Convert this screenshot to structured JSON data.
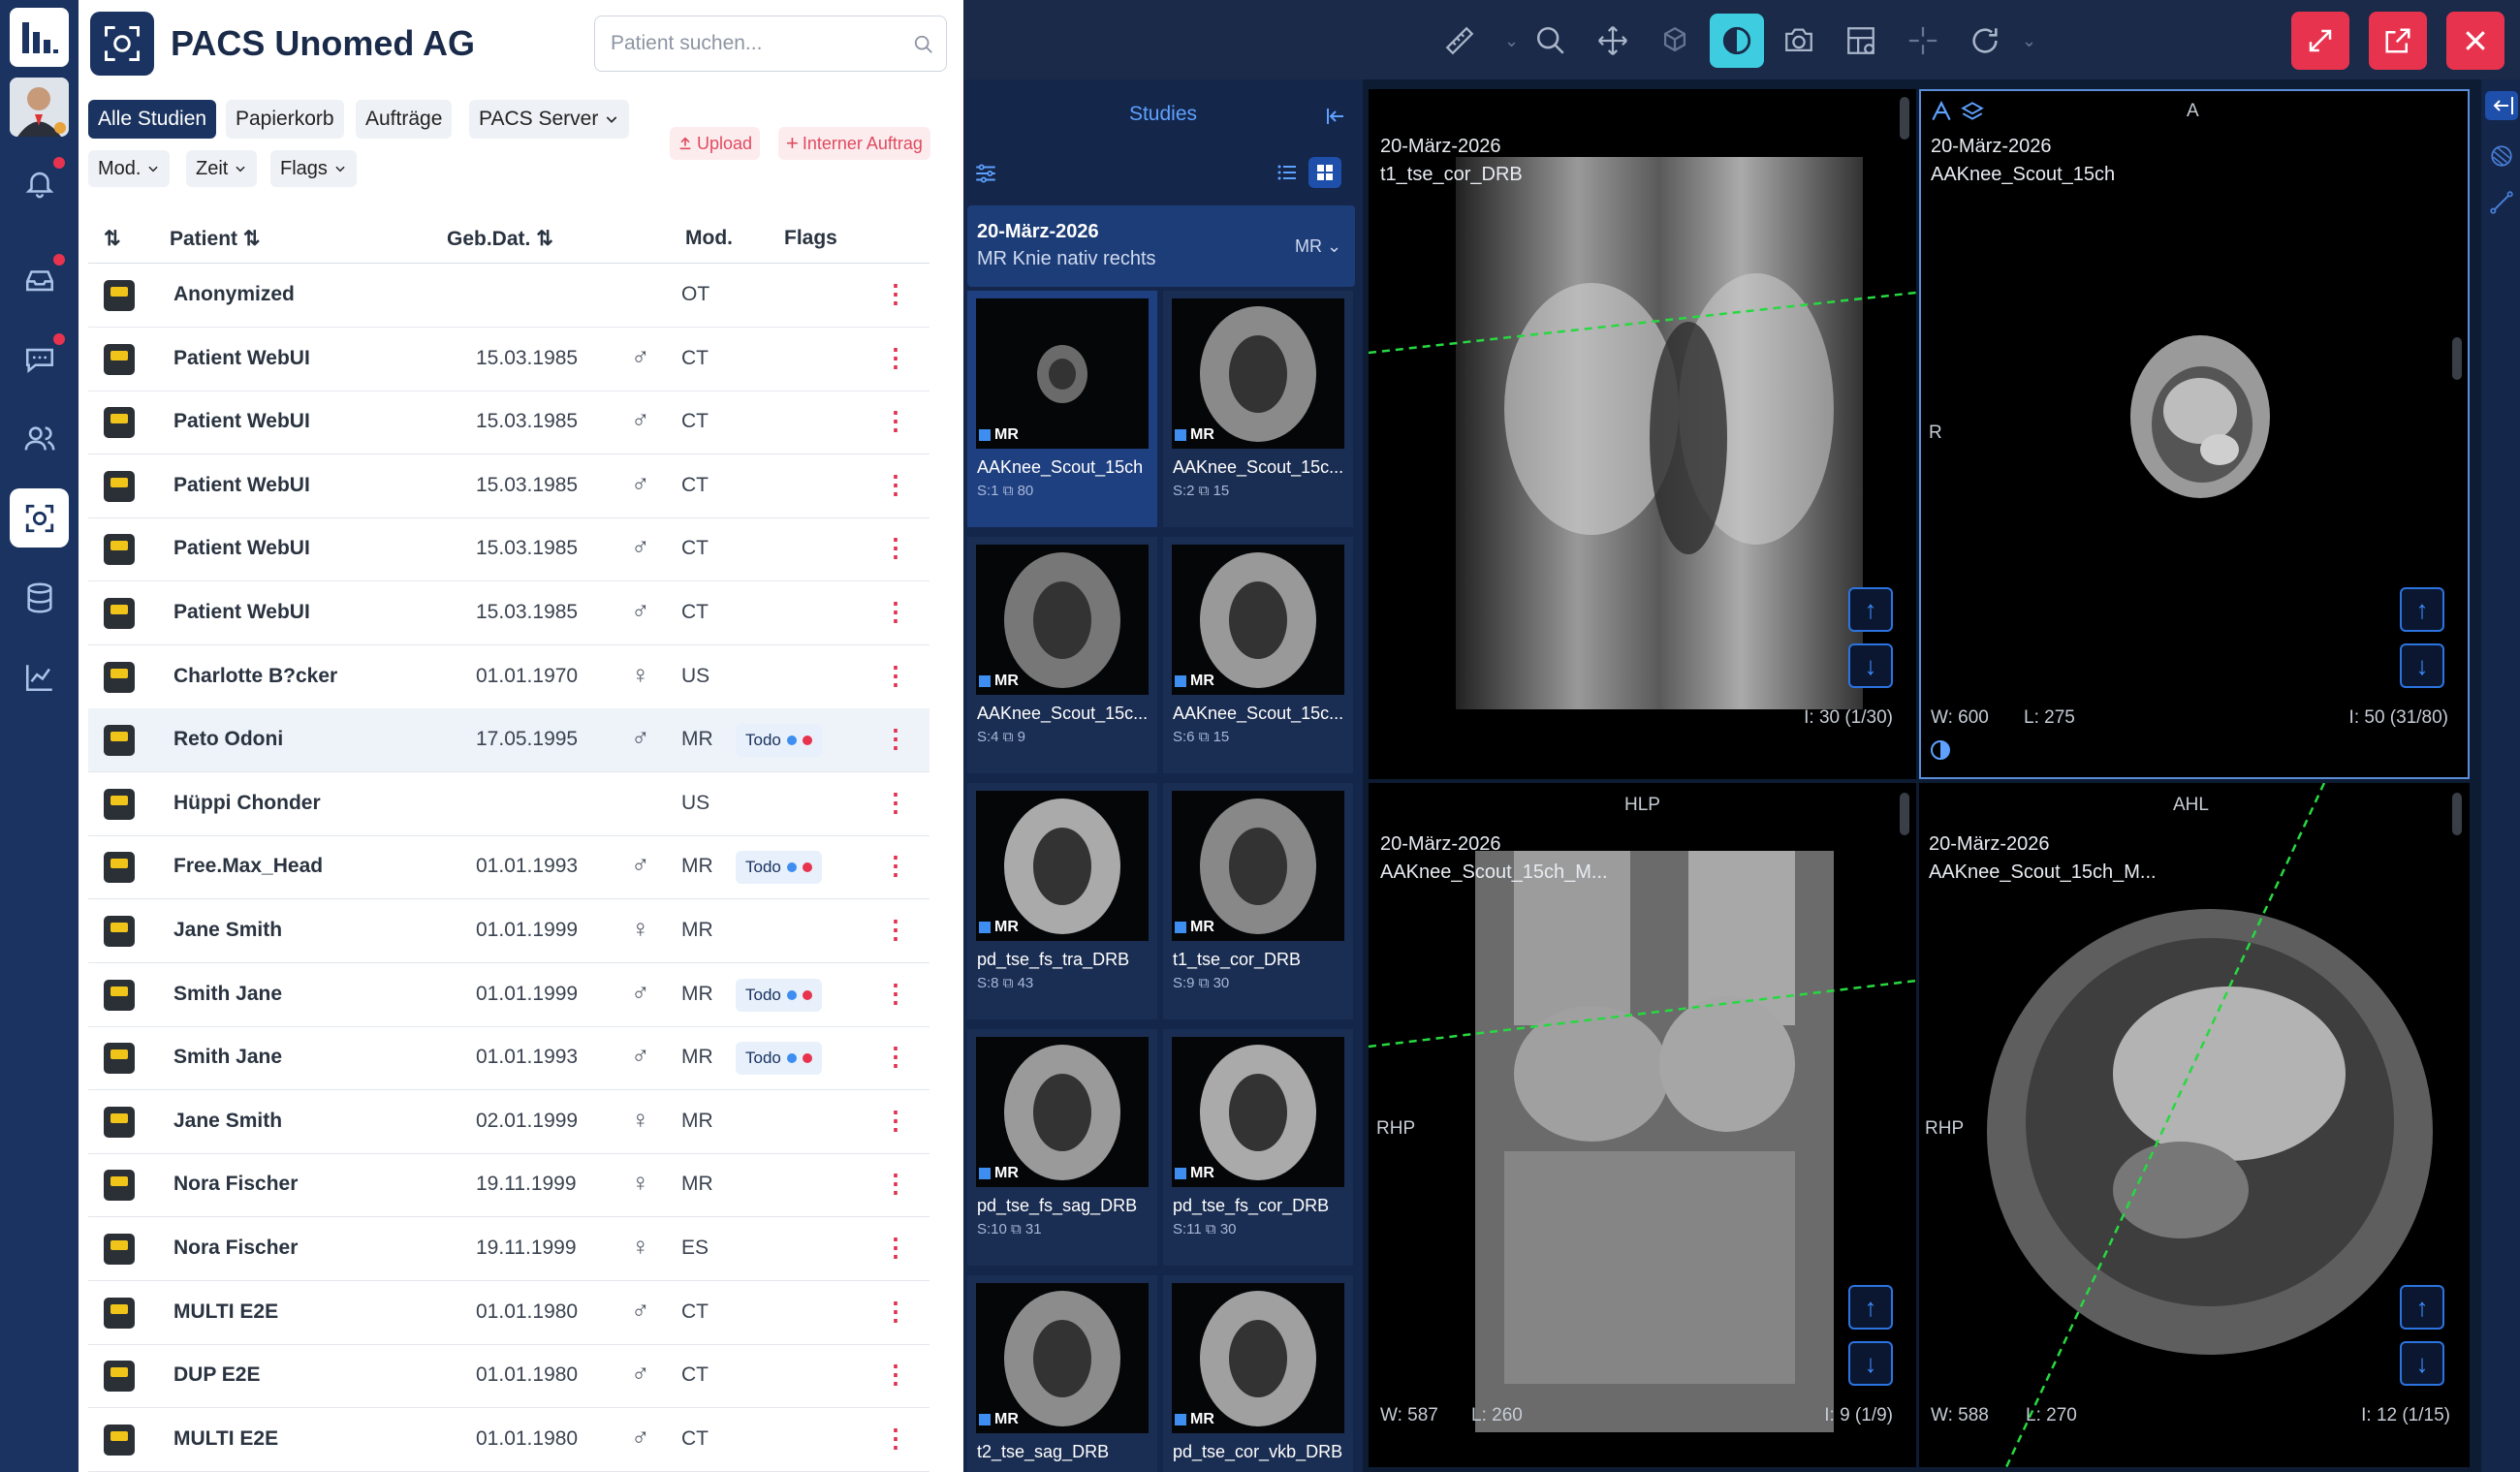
{
  "org": {
    "name": "PACS Unomed AG"
  },
  "search": {
    "placeholder": "Patient suchen..."
  },
  "tabs": [
    "Alle Studien",
    "Papierkorb",
    "Aufträge",
    "PACS Server"
  ],
  "filters": [
    "Mod.",
    "Zeit",
    "Flags"
  ],
  "actions": {
    "upload": "Upload",
    "internal": "Interner Auftrag"
  },
  "table": {
    "headers": {
      "patient": "Patient",
      "dob": "Geb.Dat.",
      "mod": "Mod.",
      "flags": "Flags"
    },
    "rows": [
      {
        "name": "Anonymized",
        "dob": "",
        "sex": "",
        "mod": "OT",
        "flag": ""
      },
      {
        "name": "Patient WebUI",
        "dob": "15.03.1985",
        "sex": "♂",
        "mod": "CT",
        "flag": ""
      },
      {
        "name": "Patient WebUI",
        "dob": "15.03.1985",
        "sex": "♂",
        "mod": "CT",
        "flag": ""
      },
      {
        "name": "Patient WebUI",
        "dob": "15.03.1985",
        "sex": "♂",
        "mod": "CT",
        "flag": ""
      },
      {
        "name": "Patient WebUI",
        "dob": "15.03.1985",
        "sex": "♂",
        "mod": "CT",
        "flag": ""
      },
      {
        "name": "Patient WebUI",
        "dob": "15.03.1985",
        "sex": "♂",
        "mod": "CT",
        "flag": ""
      },
      {
        "name": "Charlotte B?cker",
        "dob": "01.01.1970",
        "sex": "♀",
        "mod": "US",
        "flag": ""
      },
      {
        "name": "Reto Odoni",
        "dob": "17.05.1995",
        "sex": "♂",
        "mod": "MR",
        "flag": "Todo"
      },
      {
        "name": "Hüppi Chonder",
        "dob": "",
        "sex": "",
        "mod": "US",
        "flag": ""
      },
      {
        "name": "Free.Max_Head",
        "dob": "01.01.1993",
        "sex": "♂",
        "mod": "MR",
        "flag": "Todo"
      },
      {
        "name": "Jane Smith",
        "dob": "01.01.1999",
        "sex": "♀",
        "mod": "MR",
        "flag": ""
      },
      {
        "name": "Smith Jane",
        "dob": "01.01.1999",
        "sex": "♂",
        "mod": "MR",
        "flag": "Todo"
      },
      {
        "name": "Smith Jane",
        "dob": "01.01.1993",
        "sex": "♂",
        "mod": "MR",
        "flag": "Todo"
      },
      {
        "name": "Jane Smith",
        "dob": "02.01.1999",
        "sex": "♀",
        "mod": "MR",
        "flag": ""
      },
      {
        "name": "Nora Fischer",
        "dob": "19.11.1999",
        "sex": "♀",
        "mod": "MR",
        "flag": ""
      },
      {
        "name": "Nora Fischer",
        "dob": "19.11.1999",
        "sex": "♀",
        "mod": "ES",
        "flag": ""
      },
      {
        "name": "MULTI E2E",
        "dob": "01.01.1980",
        "sex": "♂",
        "mod": "CT",
        "flag": ""
      },
      {
        "name": "DUP E2E",
        "dob": "01.01.1980",
        "sex": "♂",
        "mod": "CT",
        "flag": ""
      },
      {
        "name": "MULTI E2E",
        "dob": "01.01.1980",
        "sex": "♂",
        "mod": "CT",
        "flag": ""
      }
    ]
  },
  "studies": {
    "title": "Studies",
    "study": {
      "date": "20-März-2026",
      "description": "MR Knie nativ rechts",
      "modality": "MR"
    },
    "series": [
      {
        "mod": "MR",
        "desc": "AAKnee_Scout_15ch",
        "s": "S:1",
        "count": "80"
      },
      {
        "mod": "MR",
        "desc": "AAKnee_Scout_15c...",
        "s": "S:2",
        "count": "15"
      },
      {
        "mod": "MR",
        "desc": "AAKnee_Scout_15c...",
        "s": "S:4",
        "count": "9"
      },
      {
        "mod": "MR",
        "desc": "AAKnee_Scout_15c...",
        "s": "S:6",
        "count": "15"
      },
      {
        "mod": "MR",
        "desc": "pd_tse_fs_tra_DRB",
        "s": "S:8",
        "count": "43"
      },
      {
        "mod": "MR",
        "desc": "t1_tse_cor_DRB",
        "s": "S:9",
        "count": "30"
      },
      {
        "mod": "MR",
        "desc": "pd_tse_fs_sag_DRB",
        "s": "S:10",
        "count": "31"
      },
      {
        "mod": "MR",
        "desc": "pd_tse_fs_cor_DRB",
        "s": "S:11",
        "count": "30"
      },
      {
        "mod": "MR",
        "desc": "t2_tse_sag_DRB",
        "s": "",
        "count": ""
      },
      {
        "mod": "MR",
        "desc": "pd_tse_cor_vkb_DRB",
        "s": "",
        "count": ""
      }
    ]
  },
  "viewports": [
    {
      "date": "20-März-2026",
      "series": "t1_tse_cor_DRB",
      "orient": "",
      "left": "",
      "wl": "",
      "image": "I: 30 (1/30)"
    },
    {
      "date": "20-März-2026",
      "series": "AAKnee_Scout_15ch",
      "orient": "A",
      "left": "R",
      "w": "W: 600",
      "l": "L: 275",
      "image": "I: 50 (31/80)"
    },
    {
      "date": "20-März-2026",
      "series": "AAKnee_Scout_15ch_M...",
      "orient": "HLP",
      "left": "RHP",
      "w": "W: 587",
      "l": "L: 260",
      "image": "I: 9 (1/9)"
    },
    {
      "date": "20-März-2026",
      "series": "AAKnee_Scout_15ch_M...",
      "orient": "AHL",
      "left": "RHP",
      "w": "W: 588",
      "l": "L: 270",
      "image": "I: 12 (1/15)"
    }
  ],
  "colors": {
    "accent": "#1a3360",
    "alert": "#e8334f",
    "active_tool": "#3ecde0"
  }
}
